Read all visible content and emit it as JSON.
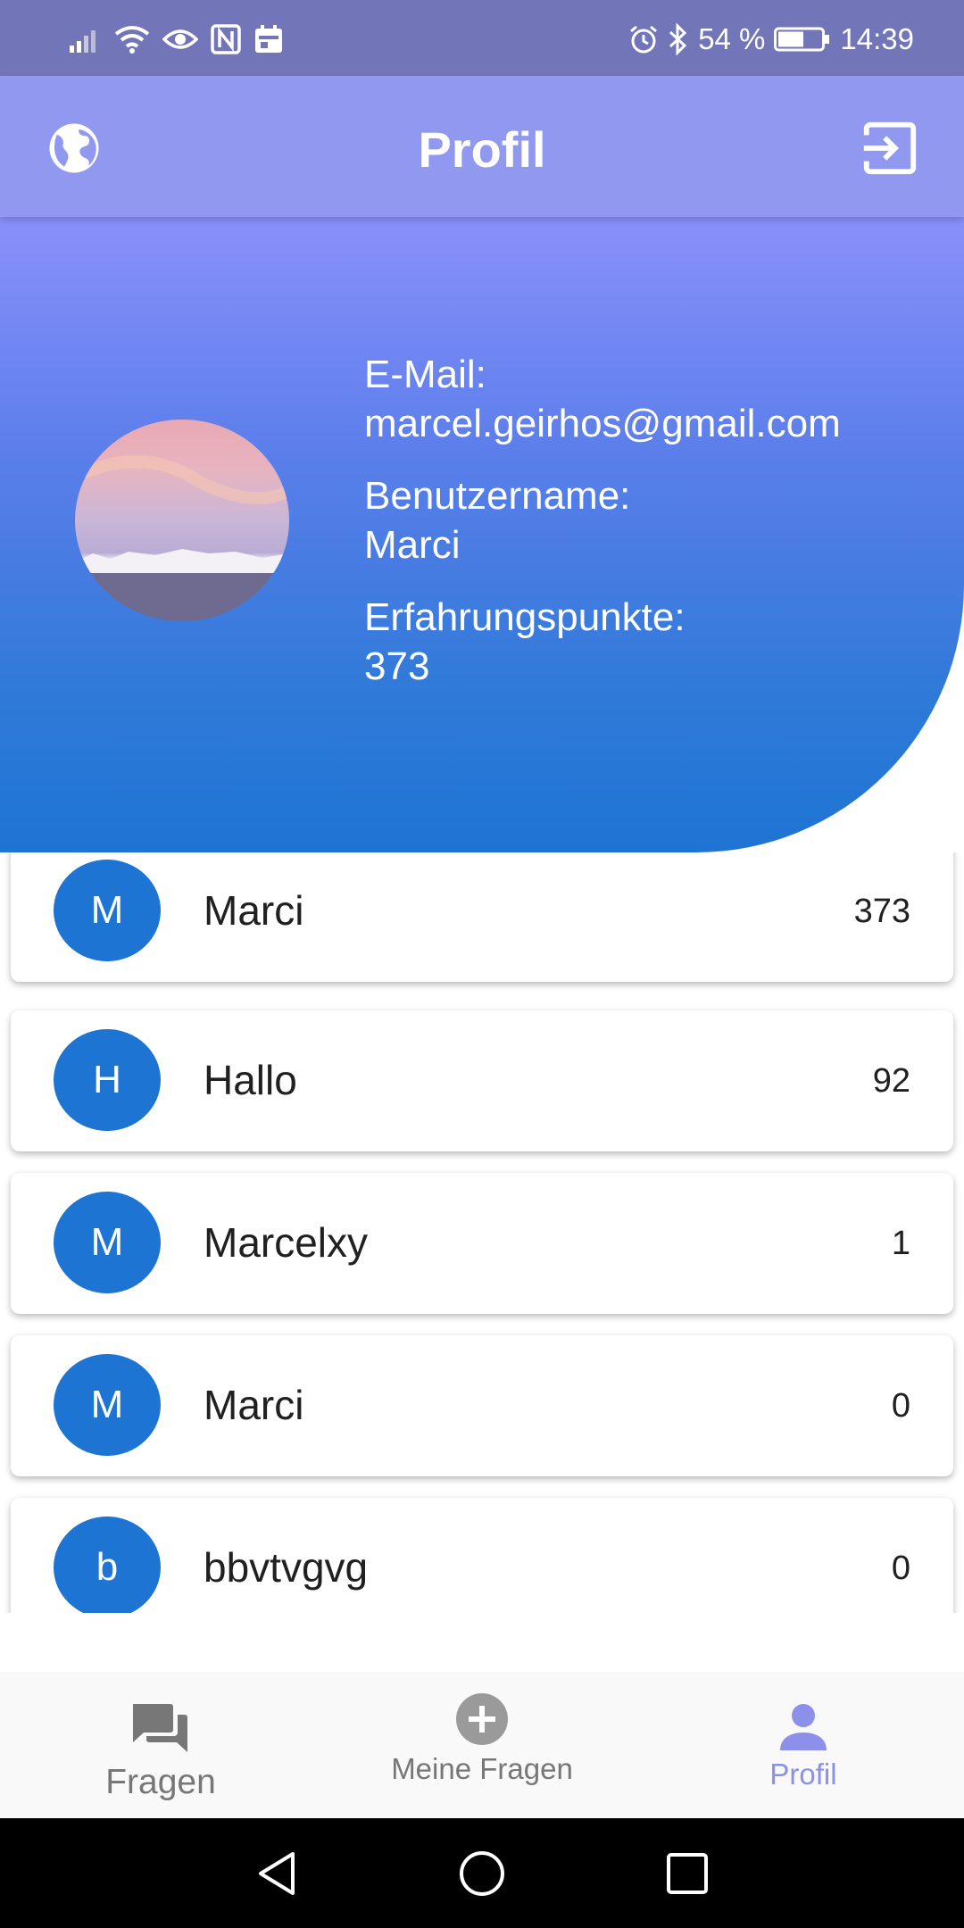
{
  "status_bar": {
    "battery": "54 %",
    "time": "14:39"
  },
  "app_bar": {
    "title": "Profil",
    "left_icon": "globe-icon",
    "right_icon": "exit-icon"
  },
  "profile": {
    "email_label": "E-Mail:",
    "email": "marcel.geirhos@gmail.com",
    "username_label": "Benutzername:",
    "username": "Marci",
    "xp_label": "Erfahrungspunkte:",
    "xp": "373"
  },
  "leaderboard": [
    {
      "initial": "M",
      "name": "Marci",
      "points": "373"
    },
    {
      "initial": "H",
      "name": "Hallo",
      "points": "92"
    },
    {
      "initial": "M",
      "name": "Marcelxy",
      "points": "1"
    },
    {
      "initial": "M",
      "name": "Marci",
      "points": "0"
    },
    {
      "initial": "b",
      "name": "bbvtvgvg",
      "points": "0"
    }
  ],
  "bottom_nav": {
    "fragen": "Fragen",
    "meine_fragen": "Meine Fragen",
    "profil": "Profil"
  },
  "colors": {
    "status_bar": "#7276b9",
    "app_bar": "#9198f0",
    "avatar_blue": "#1e74d3",
    "active_nav": "#8c90ea"
  }
}
